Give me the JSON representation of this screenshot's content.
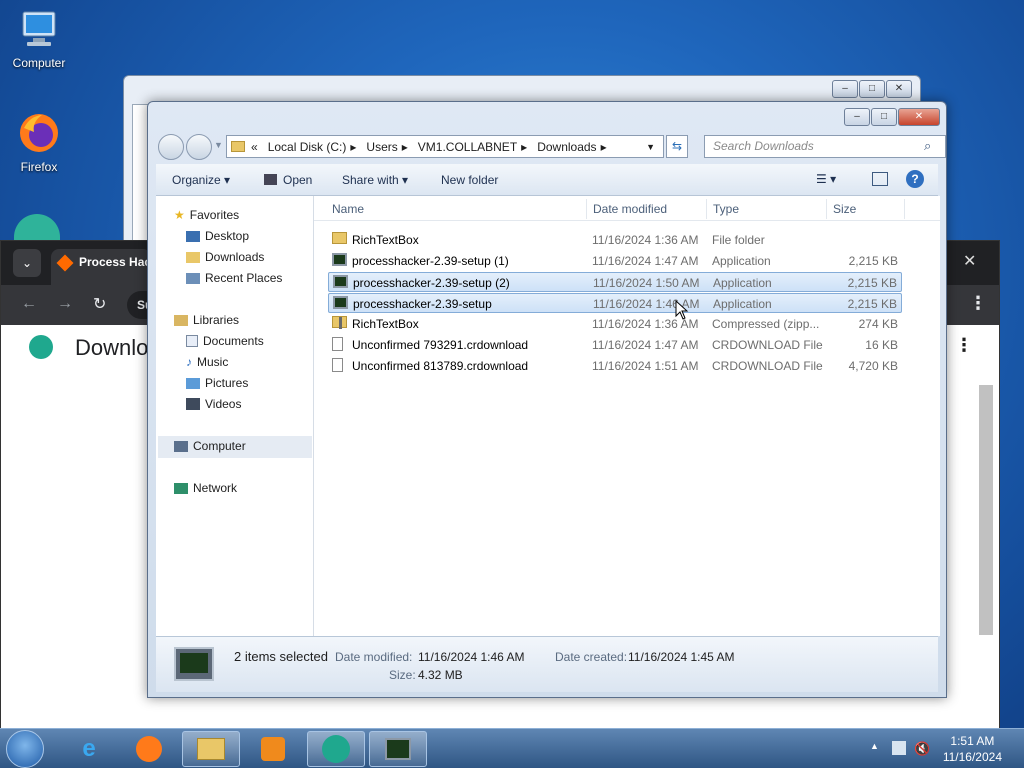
{
  "desktop": {
    "icons": [
      {
        "label": "Computer"
      },
      {
        "label": "Firefox"
      }
    ]
  },
  "browser": {
    "tab_title": "Process Hack",
    "address_fragment": "Su",
    "page_heading": "Downlo"
  },
  "explorer": {
    "breadcrumb": {
      "overflow": "«",
      "parts": [
        "Local Disk (C:)",
        "Users",
        "VM1.COLLABNET",
        "Downloads"
      ]
    },
    "search_placeholder": "Search Downloads",
    "toolbar": {
      "organize": "Organize",
      "open": "Open",
      "share_with": "Share with",
      "new_folder": "New folder"
    },
    "nav": {
      "favorites": "Favorites",
      "desktop": "Desktop",
      "downloads": "Downloads",
      "recent_places": "Recent Places",
      "libraries": "Libraries",
      "documents": "Documents",
      "music": "Music",
      "pictures": "Pictures",
      "videos": "Videos",
      "computer": "Computer",
      "network": "Network"
    },
    "columns": {
      "name": "Name",
      "date": "Date modified",
      "type": "Type",
      "size": "Size"
    },
    "files": [
      {
        "name": "RichTextBox",
        "date": "11/16/2024 1:36 AM",
        "type": "File folder",
        "size": "",
        "icon": "folder-icon",
        "selected": false
      },
      {
        "name": "processhacker-2.39-setup (1)",
        "date": "11/16/2024 1:47 AM",
        "type": "Application",
        "size": "2,215 KB",
        "icon": "app-icon",
        "selected": false
      },
      {
        "name": "processhacker-2.39-setup (2)",
        "date": "11/16/2024 1:50 AM",
        "type": "Application",
        "size": "2,215 KB",
        "icon": "app-icon",
        "selected": true
      },
      {
        "name": "processhacker-2.39-setup",
        "date": "11/16/2024 1:46 AM",
        "type": "Application",
        "size": "2,215 KB",
        "icon": "app-icon",
        "selected": true
      },
      {
        "name": "RichTextBox",
        "date": "11/16/2024 1:36 AM",
        "type": "Compressed (zipp...",
        "size": "274 KB",
        "icon": "zip-folder-icon",
        "selected": false
      },
      {
        "name": "Unconfirmed 793291.crdownload",
        "date": "11/16/2024 1:47 AM",
        "type": "CRDOWNLOAD File",
        "size": "16 KB",
        "icon": "file-icon",
        "selected": false
      },
      {
        "name": "Unconfirmed 813789.crdownload",
        "date": "11/16/2024 1:51 AM",
        "type": "CRDOWNLOAD File",
        "size": "4,720 KB",
        "icon": "file-icon",
        "selected": false
      }
    ],
    "details": {
      "count": "2 items selected",
      "modified_label": "Date modified:",
      "modified_value": "11/16/2024 1:46 AM",
      "created_label": "Date created:",
      "created_value": "11/16/2024 1:45 AM",
      "size_label": "Size:",
      "size_value": "4.32 MB"
    }
  },
  "taskbar": {
    "time": "1:51 AM",
    "date": "11/16/2024"
  }
}
